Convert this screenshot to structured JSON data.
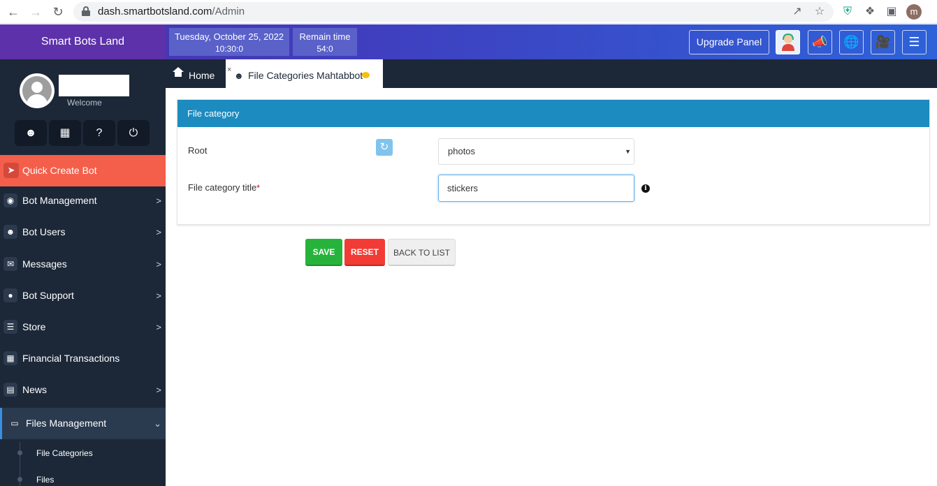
{
  "browser": {
    "url_host": "dash.smartbotsland.com",
    "url_path": "/Admin",
    "profile_initial": "m",
    "icons": [
      "back-arrow-icon",
      "forward-arrow-icon",
      "reload-icon",
      "lock-icon",
      "share-icon",
      "star-icon",
      "extension-shield-icon",
      "puzzle-icon",
      "sidepanel-icon"
    ]
  },
  "header": {
    "brand": "Smart Bots Land",
    "date": "Tuesday, October 25, 2022",
    "time": "10:30:0",
    "remain_label": "Remain time",
    "remain_value": "54:0",
    "upgrade_label": "Upgrade Panel",
    "icons": [
      "support-agent-icon",
      "megaphone-icon",
      "globe-icon",
      "video-camera-icon",
      "signpost-icon"
    ]
  },
  "sidebar": {
    "welcome": "Welcome",
    "quick_buttons": [
      "user-icon",
      "receipt-icon",
      "help-icon",
      "power-icon"
    ],
    "quick_create": "Quick Create Bot",
    "items": [
      {
        "label": "Bot Management",
        "icon": "android-icon",
        "arrow": ">"
      },
      {
        "label": "Bot Users",
        "icon": "users-icon",
        "arrow": ">"
      },
      {
        "label": "Messages",
        "icon": "envelope-icon",
        "arrow": ">"
      },
      {
        "label": "Bot Support",
        "icon": "support-icon",
        "arrow": ">"
      },
      {
        "label": "Store",
        "icon": "cart-icon",
        "arrow": ">"
      },
      {
        "label": "Financial Transactions",
        "icon": "receipt-icon",
        "arrow": ""
      },
      {
        "label": "News",
        "icon": "newspaper-icon",
        "arrow": ">"
      },
      {
        "label": "Files Management",
        "icon": "folder-icon",
        "arrow": "⌄"
      }
    ],
    "sub_items": [
      "File Categories",
      "Files"
    ]
  },
  "tabs": {
    "home": "Home",
    "active": "File Categories Mahtabbot"
  },
  "form": {
    "panel_title": "File category",
    "root_label": "Root",
    "root_value": "photos",
    "title_label": "File category title",
    "required_mark": "*",
    "title_value": "stickers",
    "save": "SAVE",
    "reset": "RESET",
    "back": "BACK TO LIST"
  },
  "colors": {
    "header_brand": "#5d31a9",
    "sidebar_bg": "#1c2838",
    "quick_create": "#f45f4b",
    "panel_head": "#1b8bc0",
    "save": "#27b33b",
    "reset": "#f23b35"
  }
}
